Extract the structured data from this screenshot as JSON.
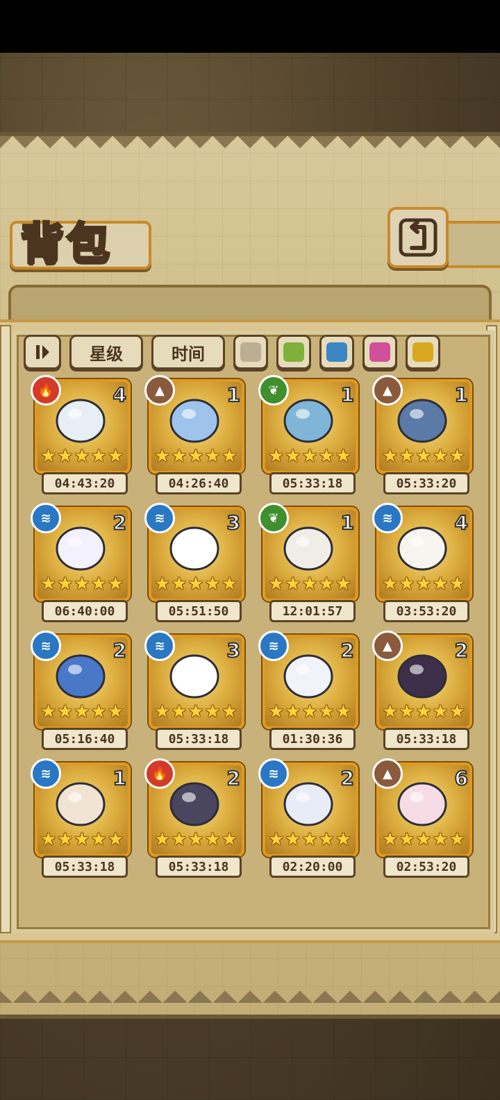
{
  "title": "背包",
  "sort_buttons": {
    "star": "星级",
    "time": "时间"
  },
  "filter_colors": [
    "#bcae94",
    "#7fb03a",
    "#3c86c4",
    "#d0509a",
    "#d8a820"
  ],
  "items": [
    {
      "element": "fire",
      "count": "4",
      "timer": "04:43:20",
      "stars": 5,
      "art": "wizard-hat-icon"
    },
    {
      "element": "earth",
      "count": "1",
      "timer": "04:26:40",
      "stars": 5,
      "art": "rabbit-doll-icon"
    },
    {
      "element": "leaf",
      "count": "1",
      "timer": "05:33:18",
      "stars": 5,
      "art": "mirror-icon"
    },
    {
      "element": "earth",
      "count": "1",
      "timer": "05:33:20",
      "stars": 5,
      "art": "hammer-icon"
    },
    {
      "element": "water",
      "count": "2",
      "timer": "06:40:00",
      "stars": 5,
      "art": "winged-egg-icon"
    },
    {
      "element": "water",
      "count": "3",
      "timer": "05:51:50",
      "stars": 5,
      "art": "panda-icon"
    },
    {
      "element": "leaf",
      "count": "1",
      "timer": "12:01:57",
      "stars": 5,
      "art": "laurel-egg-icon"
    },
    {
      "element": "water",
      "count": "4",
      "timer": "03:53:20",
      "stars": 5,
      "art": "vine-egg-icon"
    },
    {
      "element": "water",
      "count": "2",
      "timer": "05:16:40",
      "stars": 5,
      "art": "blue-wing-icon"
    },
    {
      "element": "water",
      "count": "3",
      "timer": "05:33:18",
      "stars": 5,
      "art": "ribbon-hat-icon"
    },
    {
      "element": "water",
      "count": "2",
      "timer": "01:30:36",
      "stars": 5,
      "art": "heart-egg-icon"
    },
    {
      "element": "earth",
      "count": "2",
      "timer": "05:33:18",
      "stars": 5,
      "art": "beetle-icon"
    },
    {
      "element": "water",
      "count": "1",
      "timer": "05:33:18",
      "stars": 5,
      "art": "angel-egg-icon"
    },
    {
      "element": "fire",
      "count": "2",
      "timer": "05:33:18",
      "stars": 5,
      "art": "dark-bat-icon"
    },
    {
      "element": "water",
      "count": "2",
      "timer": "02:20:00",
      "stars": 5,
      "art": "frill-egg-icon"
    },
    {
      "element": "earth",
      "count": "6",
      "timer": "02:53:20",
      "stars": 5,
      "art": "pink-bow-egg-icon"
    }
  ]
}
